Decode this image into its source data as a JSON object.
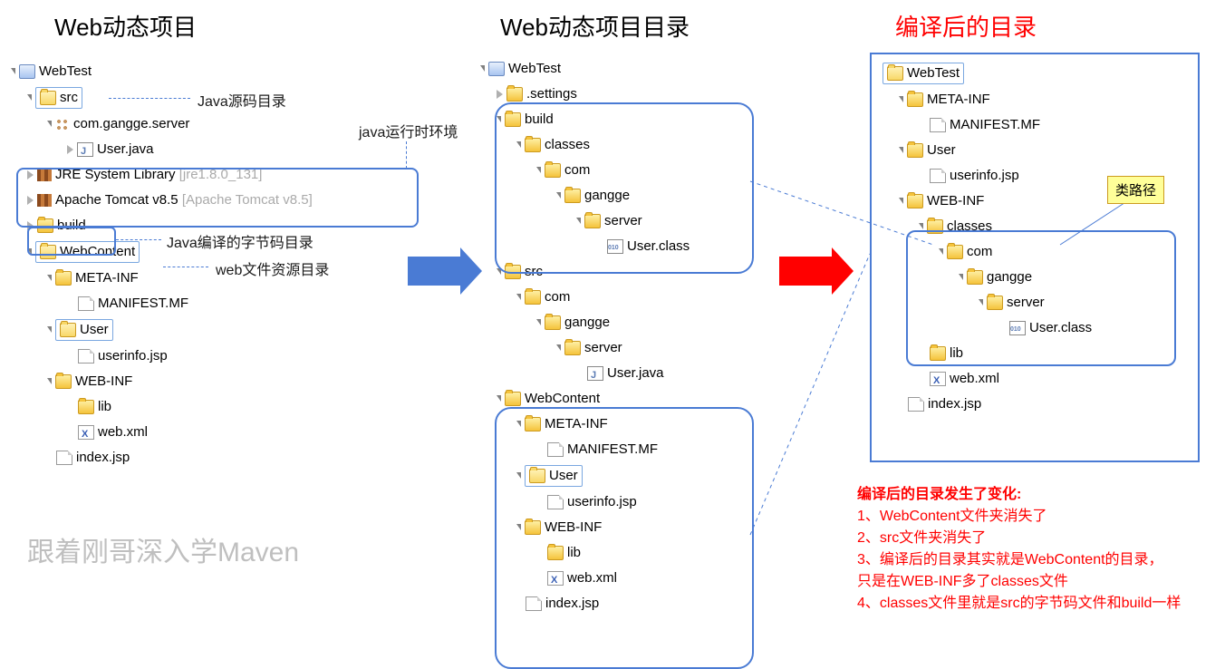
{
  "titles": {
    "left": "Web动态项目",
    "mid": "Web动态项目目录",
    "right": "编译后的目录"
  },
  "tree1": {
    "root": "WebTest",
    "src": "src",
    "pkg": "com.gangge.server",
    "userjava": "User.java",
    "jre": "JRE System Library ",
    "jreVer": "[jre1.8.0_131]",
    "tomcat": "Apache Tomcat v8.5 ",
    "tomcatVer": "[Apache Tomcat v8.5]",
    "build": "build",
    "webcontent": "WebContent",
    "metainf": "META-INF",
    "manifest": "MANIFEST.MF",
    "user": "User",
    "userinfo": "userinfo.jsp",
    "webinf": "WEB-INF",
    "lib": "lib",
    "webxml": "web.xml",
    "index": "index.jsp"
  },
  "annot": {
    "src": "Java源码目录",
    "runtime": "java运行时环境",
    "build": "Java编译的字节码目录",
    "web": "web文件资源目录"
  },
  "tree2": {
    "root": "WebTest",
    "settings": ".settings",
    "build": "build",
    "classes": "classes",
    "com": "com",
    "gangge": "gangge",
    "server": "server",
    "userclass": "User.class",
    "src": "src",
    "userjava": "User.java",
    "webcontent": "WebContent",
    "metainf": "META-INF",
    "manifest": "MANIFEST.MF",
    "user": "User",
    "userinfo": "userinfo.jsp",
    "webinf": "WEB-INF",
    "lib": "lib",
    "webxml": "web.xml",
    "index": "index.jsp"
  },
  "tree3": {
    "root": "WebTest",
    "metainf": "META-INF",
    "manifest": "MANIFEST.MF",
    "user": "User",
    "userinfo": "userinfo.jsp",
    "webinf": "WEB-INF",
    "classes": "classes",
    "com": "com",
    "gangge": "gangge",
    "server": "server",
    "userclass": "User.class",
    "lib": "lib",
    "webxml": "web.xml",
    "index": "index.jsp"
  },
  "classpath": "类路径",
  "notes": {
    "hd": "编译后的目录发生了变化:",
    "l1": "1、WebContent文件夹消失了",
    "l2": "2、src文件夹消失了",
    "l3a": "3、编译后的目录其实就是WebContent的目录，",
    "l3b": "      只是在WEB-INF多了classes文件",
    "l4": "4、classes文件里就是src的字节码文件和build一样"
  },
  "watermark": "跟着刚哥深入学Maven"
}
